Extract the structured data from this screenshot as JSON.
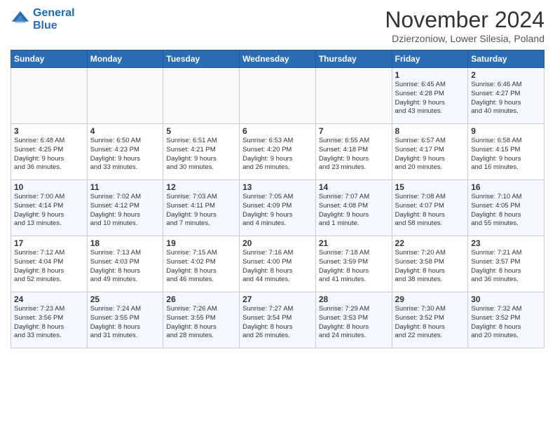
{
  "logo": {
    "line1": "General",
    "line2": "Blue"
  },
  "title": "November 2024",
  "subtitle": "Dzierzoniow, Lower Silesia, Poland",
  "days_of_week": [
    "Sunday",
    "Monday",
    "Tuesday",
    "Wednesday",
    "Thursday",
    "Friday",
    "Saturday"
  ],
  "weeks": [
    [
      {
        "day": "",
        "info": ""
      },
      {
        "day": "",
        "info": ""
      },
      {
        "day": "",
        "info": ""
      },
      {
        "day": "",
        "info": ""
      },
      {
        "day": "",
        "info": ""
      },
      {
        "day": "1",
        "info": "Sunrise: 6:45 AM\nSunset: 4:28 PM\nDaylight: 9 hours\nand 43 minutes."
      },
      {
        "day": "2",
        "info": "Sunrise: 6:46 AM\nSunset: 4:27 PM\nDaylight: 9 hours\nand 40 minutes."
      }
    ],
    [
      {
        "day": "3",
        "info": "Sunrise: 6:48 AM\nSunset: 4:25 PM\nDaylight: 9 hours\nand 36 minutes."
      },
      {
        "day": "4",
        "info": "Sunrise: 6:50 AM\nSunset: 4:23 PM\nDaylight: 9 hours\nand 33 minutes."
      },
      {
        "day": "5",
        "info": "Sunrise: 6:51 AM\nSunset: 4:21 PM\nDaylight: 9 hours\nand 30 minutes."
      },
      {
        "day": "6",
        "info": "Sunrise: 6:53 AM\nSunset: 4:20 PM\nDaylight: 9 hours\nand 26 minutes."
      },
      {
        "day": "7",
        "info": "Sunrise: 6:55 AM\nSunset: 4:18 PM\nDaylight: 9 hours\nand 23 minutes."
      },
      {
        "day": "8",
        "info": "Sunrise: 6:57 AM\nSunset: 4:17 PM\nDaylight: 9 hours\nand 20 minutes."
      },
      {
        "day": "9",
        "info": "Sunrise: 6:58 AM\nSunset: 4:15 PM\nDaylight: 9 hours\nand 16 minutes."
      }
    ],
    [
      {
        "day": "10",
        "info": "Sunrise: 7:00 AM\nSunset: 4:14 PM\nDaylight: 9 hours\nand 13 minutes."
      },
      {
        "day": "11",
        "info": "Sunrise: 7:02 AM\nSunset: 4:12 PM\nDaylight: 9 hours\nand 10 minutes."
      },
      {
        "day": "12",
        "info": "Sunrise: 7:03 AM\nSunset: 4:11 PM\nDaylight: 9 hours\nand 7 minutes."
      },
      {
        "day": "13",
        "info": "Sunrise: 7:05 AM\nSunset: 4:09 PM\nDaylight: 9 hours\nand 4 minutes."
      },
      {
        "day": "14",
        "info": "Sunrise: 7:07 AM\nSunset: 4:08 PM\nDaylight: 9 hours\nand 1 minute."
      },
      {
        "day": "15",
        "info": "Sunrise: 7:08 AM\nSunset: 4:07 PM\nDaylight: 8 hours\nand 58 minutes."
      },
      {
        "day": "16",
        "info": "Sunrise: 7:10 AM\nSunset: 4:05 PM\nDaylight: 8 hours\nand 55 minutes."
      }
    ],
    [
      {
        "day": "17",
        "info": "Sunrise: 7:12 AM\nSunset: 4:04 PM\nDaylight: 8 hours\nand 52 minutes."
      },
      {
        "day": "18",
        "info": "Sunrise: 7:13 AM\nSunset: 4:03 PM\nDaylight: 8 hours\nand 49 minutes."
      },
      {
        "day": "19",
        "info": "Sunrise: 7:15 AM\nSunset: 4:02 PM\nDaylight: 8 hours\nand 46 minutes."
      },
      {
        "day": "20",
        "info": "Sunrise: 7:16 AM\nSunset: 4:00 PM\nDaylight: 8 hours\nand 44 minutes."
      },
      {
        "day": "21",
        "info": "Sunrise: 7:18 AM\nSunset: 3:59 PM\nDaylight: 8 hours\nand 41 minutes."
      },
      {
        "day": "22",
        "info": "Sunrise: 7:20 AM\nSunset: 3:58 PM\nDaylight: 8 hours\nand 38 minutes."
      },
      {
        "day": "23",
        "info": "Sunrise: 7:21 AM\nSunset: 3:57 PM\nDaylight: 8 hours\nand 36 minutes."
      }
    ],
    [
      {
        "day": "24",
        "info": "Sunrise: 7:23 AM\nSunset: 3:56 PM\nDaylight: 8 hours\nand 33 minutes."
      },
      {
        "day": "25",
        "info": "Sunrise: 7:24 AM\nSunset: 3:55 PM\nDaylight: 8 hours\nand 31 minutes."
      },
      {
        "day": "26",
        "info": "Sunrise: 7:26 AM\nSunset: 3:55 PM\nDaylight: 8 hours\nand 28 minutes."
      },
      {
        "day": "27",
        "info": "Sunrise: 7:27 AM\nSunset: 3:54 PM\nDaylight: 8 hours\nand 26 minutes."
      },
      {
        "day": "28",
        "info": "Sunrise: 7:29 AM\nSunset: 3:53 PM\nDaylight: 8 hours\nand 24 minutes."
      },
      {
        "day": "29",
        "info": "Sunrise: 7:30 AM\nSunset: 3:52 PM\nDaylight: 8 hours\nand 22 minutes."
      },
      {
        "day": "30",
        "info": "Sunrise: 7:32 AM\nSunset: 3:52 PM\nDaylight: 8 hours\nand 20 minutes."
      }
    ]
  ]
}
